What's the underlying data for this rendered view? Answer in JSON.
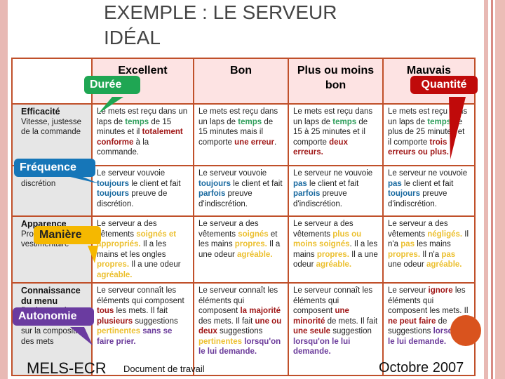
{
  "title": "EXEMPLE : LE SERVEUR IDÉAL",
  "columns": [
    "",
    "Excellent",
    "Bon",
    "Plus ou moins bon",
    "Mauvais"
  ],
  "rows": [
    {
      "header": "Efficacité",
      "desc": "Vitesse, justesse de la commande",
      "cells": [
        [
          {
            "t": "Le mets est reçu dans un laps de "
          },
          {
            "t": "temps",
            "c": "g"
          },
          {
            "t": " de 15 minutes et il "
          },
          {
            "t": "totalement conforme",
            "c": "r"
          },
          {
            "t": " à la commande."
          }
        ],
        [
          {
            "t": "Le mets est reçu dans un laps de "
          },
          {
            "t": "temps",
            "c": "g"
          },
          {
            "t": " de 15 minutes mais il comporte "
          },
          {
            "t": "une erreur",
            "c": "r"
          },
          {
            "t": "."
          }
        ],
        [
          {
            "t": "Le mets est reçu dans un laps de "
          },
          {
            "t": "temps",
            "c": "g"
          },
          {
            "t": " de 15 à 25 minutes et il comporte "
          },
          {
            "t": "deux erreurs.",
            "c": "r"
          }
        ],
        [
          {
            "t": "Le mets est reçu dans un laps de "
          },
          {
            "t": "temps",
            "c": "g"
          },
          {
            "t": " de plus de 25 minutes et il comporte "
          },
          {
            "t": "trois erreurs ou plus.",
            "c": "r"
          }
        ]
      ]
    },
    {
      "header": "",
      "desc": "Vouvoiement, discrétion",
      "cells": [
        [
          {
            "t": "Le serveur vouvoie "
          },
          {
            "t": "toujours",
            "c": "b"
          },
          {
            "t": " le client et fait "
          },
          {
            "t": "toujours",
            "c": "b"
          },
          {
            "t": " preuve de discrétion."
          }
        ],
        [
          {
            "t": "Le serveur vouvoie "
          },
          {
            "t": "toujours",
            "c": "b"
          },
          {
            "t": " le client et fait "
          },
          {
            "t": "parfois",
            "c": "b"
          },
          {
            "t": " preuve d'indiscrétion."
          }
        ],
        [
          {
            "t": "Le serveur ne vouvoie "
          },
          {
            "t": "pas",
            "c": "b"
          },
          {
            "t": " le client et fait "
          },
          {
            "t": "parfois",
            "c": "b"
          },
          {
            "t": " preuve d'indiscrétion."
          }
        ],
        [
          {
            "t": "Le serveur ne vouvoie "
          },
          {
            "t": "pas",
            "c": "b"
          },
          {
            "t": " le client et fait "
          },
          {
            "t": "toujours",
            "c": "b"
          },
          {
            "t": " preuve d'indiscrétion."
          }
        ]
      ]
    },
    {
      "header": "Apparence",
      "desc": "Propreté, vestimentaire",
      "cells": [
        [
          {
            "t": "Le serveur a des vêtements "
          },
          {
            "t": "soignés et appropriés.",
            "c": "y"
          },
          {
            "t": " Il a les mains et les ongles "
          },
          {
            "t": "propres.",
            "c": "y"
          },
          {
            "t": " Il a une odeur "
          },
          {
            "t": "agréable.",
            "c": "y"
          }
        ],
        [
          {
            "t": "Le serveur a des vêtements "
          },
          {
            "t": "soignés",
            "c": "y"
          },
          {
            "t": " et les mains "
          },
          {
            "t": "propres.",
            "c": "y"
          },
          {
            "t": " Il a une odeur "
          },
          {
            "t": "agréable.",
            "c": "y"
          }
        ],
        [
          {
            "t": "Le serveur a des vêtements "
          },
          {
            "t": "plus ou moins soignés",
            "c": "y"
          },
          {
            "t": ". Il a les mains "
          },
          {
            "t": "propres.",
            "c": "y"
          },
          {
            "t": " Il a une odeur "
          },
          {
            "t": "agréable.",
            "c": "y"
          }
        ],
        [
          {
            "t": "Le serveur a des vêtements "
          },
          {
            "t": "négligés.",
            "c": "y"
          },
          {
            "t": " Il n'a "
          },
          {
            "t": "pas",
            "c": "y"
          },
          {
            "t": " les mains "
          },
          {
            "t": "propres.",
            "c": "y"
          },
          {
            "t": " Il n'a "
          },
          {
            "t": "pas",
            "c": "y"
          },
          {
            "t": " une odeur "
          },
          {
            "t": "agréable.",
            "c": "y"
          }
        ]
      ]
    },
    {
      "header": "Connaissance du menu",
      "desc": "Pertinence des connaissances sur la composition des mets",
      "cells": [
        [
          {
            "t": "Le serveur connaît les éléments qui composent "
          },
          {
            "t": "tous",
            "c": "r"
          },
          {
            "t": " les mets. Il fait "
          },
          {
            "t": "plusieurs",
            "c": "r"
          },
          {
            "t": " suggestions "
          },
          {
            "t": "pertinentes",
            "c": "y"
          },
          {
            "t": " sans se faire prier.",
            "c": "p"
          }
        ],
        [
          {
            "t": "Le serveur connaît les éléments qui composent "
          },
          {
            "t": "la majorité",
            "c": "r"
          },
          {
            "t": " des mets. Il fait "
          },
          {
            "t": "une ou deux",
            "c": "r"
          },
          {
            "t": " suggestions "
          },
          {
            "t": "pertinentes",
            "c": "y"
          },
          {
            "t": " lorsqu'on le lui demande.",
            "c": "p"
          }
        ],
        [
          {
            "t": "Le serveur connaît les éléments qui composent "
          },
          {
            "t": "une minorité",
            "c": "r"
          },
          {
            "t": " de mets. Il fait "
          },
          {
            "t": "une seule",
            "c": "r"
          },
          {
            "t": " suggestion "
          },
          {
            "t": "lorsqu'on le lui demande.",
            "c": "p"
          }
        ],
        [
          {
            "t": "Le serveur "
          },
          {
            "t": "ignore",
            "c": "r"
          },
          {
            "t": " les éléments qui composent les mets. Il "
          },
          {
            "t": "ne peut faire",
            "c": "r"
          },
          {
            "t": " de suggestions "
          },
          {
            "t": "lorsqu'on le lui demande.",
            "c": "p"
          }
        ]
      ]
    }
  ],
  "callouts": {
    "duree": "Durée",
    "frequence": "Fréquence",
    "maniere": "Manière",
    "autonomie": "Autonomie",
    "quantite": "Quantité"
  },
  "colors": {
    "duree": "#1fa653",
    "frequence": "#1676b8",
    "maniere": "#f5b800",
    "autonomie": "#6a3ba0",
    "quantite": "#c00a0a",
    "border": "#c0502a"
  },
  "footer": {
    "left": "MELS-ECR",
    "center": "Document de travail",
    "right": "Octobre 2007"
  }
}
